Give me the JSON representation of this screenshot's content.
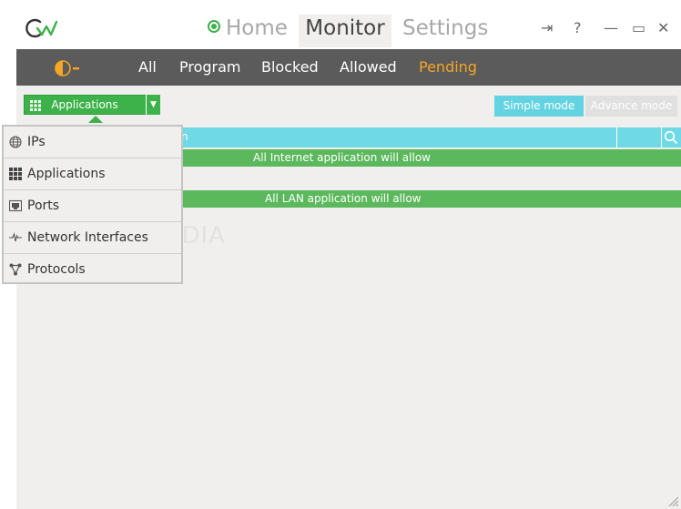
{
  "titlebar": {
    "tabs": {
      "home": "Home",
      "monitor": "Monitor",
      "settings": "Settings"
    },
    "buttons": {
      "pin": "⇥",
      "help": "?",
      "minimize": "—",
      "maximize": "▭",
      "close": "✕"
    }
  },
  "nav": {
    "items": [
      "All",
      "Program",
      "Blocked",
      "Allowed",
      "Pending"
    ],
    "active": "Pending"
  },
  "toolbar": {
    "dropdown_label": "Applications",
    "simple_mode": "Simple mode",
    "advance_mode": "Advance mode"
  },
  "table": {
    "header_text": "n",
    "rows": [
      "All Internet application  will allow",
      "All LAN application  will allow"
    ]
  },
  "menu": {
    "items": [
      {
        "label": "IPs",
        "icon": "globe-icon"
      },
      {
        "label": "Applications",
        "icon": "grid-icon"
      },
      {
        "label": "Ports",
        "icon": "port-icon"
      },
      {
        "label": "Network Interfaces",
        "icon": "pulse-icon"
      },
      {
        "label": "Protocols",
        "icon": "protocol-icon"
      }
    ]
  },
  "watermark": "SOFTPEDIA",
  "colors": {
    "accent_green": "#3db24a",
    "pending_orange": "#f5a623",
    "header_cyan": "#6fd9e6",
    "navbar_gray": "#5b5b5b"
  }
}
